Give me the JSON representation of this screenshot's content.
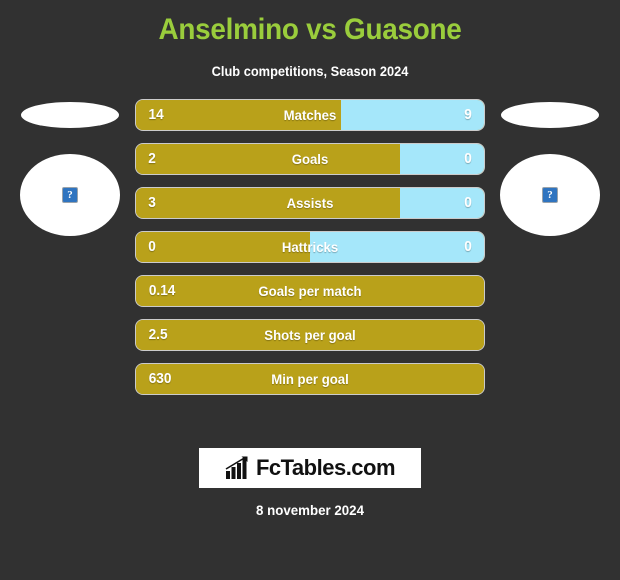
{
  "header": {
    "title": "Anselmino vs Guasone",
    "subtitle": "Club competitions, Season 2024"
  },
  "players": {
    "home": {
      "flag_icon": "flag-placeholder-icon",
      "photo_icon": "broken-image-icon",
      "broken_glyph": "?"
    },
    "away": {
      "flag_icon": "flag-placeholder-icon",
      "photo_icon": "broken-image-icon",
      "broken_glyph": "?"
    }
  },
  "footer": {
    "logo_icon": "bar-chart-growth-icon",
    "logo_text": "FcTables.com",
    "date": "8 november 2024"
  },
  "colors": {
    "background": "#313131",
    "title": "#9ACD3C",
    "home_bar": "#B9A11A",
    "away_bar": "#A5E7FA",
    "text": "#FFFFFF"
  },
  "chart_data": {
    "type": "bar",
    "title": "Anselmino vs Guasone",
    "subtitle": "Club competitions, Season 2024",
    "orientation": "horizontal-diverging",
    "series": [
      {
        "name": "Anselmino",
        "side": "home",
        "color": "#B9A11A"
      },
      {
        "name": "Guasone",
        "side": "away",
        "color": "#A5E7FA"
      }
    ],
    "categories": [
      "Matches",
      "Goals",
      "Assists",
      "Hattricks",
      "Goals per match",
      "Shots per goal",
      "Min per goal"
    ],
    "rows": [
      {
        "label": "Matches",
        "home": "14",
        "away": "9",
        "home_pct": 59,
        "two_sided": true
      },
      {
        "label": "Goals",
        "home": "2",
        "away": "0",
        "home_pct": 76,
        "two_sided": true
      },
      {
        "label": "Assists",
        "home": "3",
        "away": "0",
        "home_pct": 76,
        "two_sided": true
      },
      {
        "label": "Hattricks",
        "home": "0",
        "away": "0",
        "home_pct": 50,
        "two_sided": true
      },
      {
        "label": "Goals per match",
        "home": "0.14",
        "away": "",
        "home_pct": 100,
        "two_sided": false
      },
      {
        "label": "Shots per goal",
        "home": "2.5",
        "away": "",
        "home_pct": 100,
        "two_sided": false
      },
      {
        "label": "Min per goal",
        "home": "630",
        "away": "",
        "home_pct": 100,
        "two_sided": false
      }
    ]
  }
}
